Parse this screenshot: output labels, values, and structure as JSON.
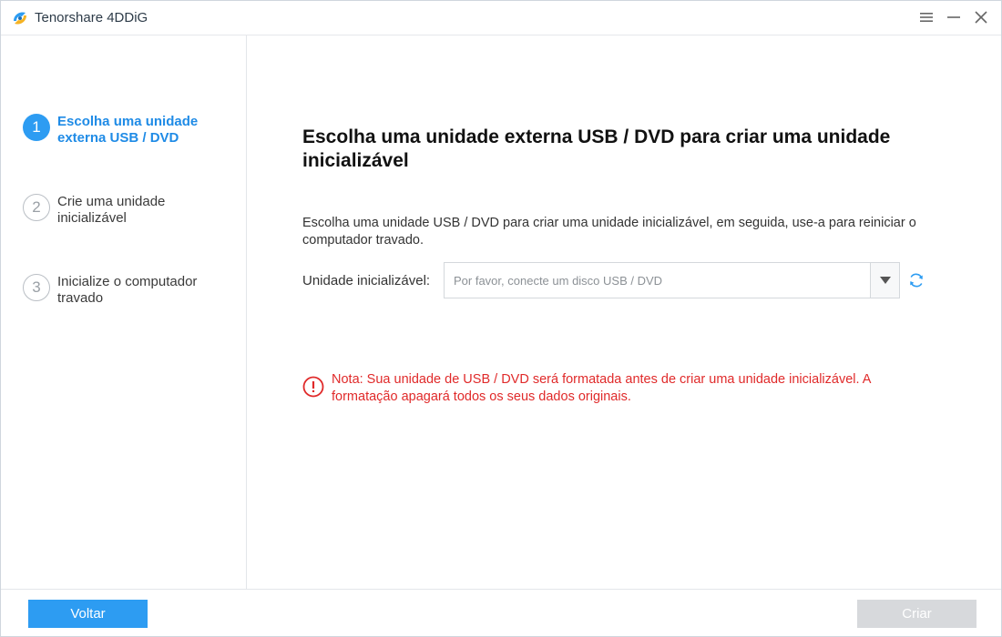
{
  "app": {
    "title": "Tenorshare 4DDiG"
  },
  "sidebar": {
    "steps": [
      {
        "number": "1",
        "label": "Escolha uma unidade externa USB / DVD",
        "state": "active"
      },
      {
        "number": "2",
        "label": "Crie uma unidade inicializável",
        "state": "inactive"
      },
      {
        "number": "3",
        "label": "Inicialize o computador travado",
        "state": "inactive"
      }
    ]
  },
  "main": {
    "title": "Escolha uma unidade externa USB / DVD para criar uma unidade inicializável",
    "description": "Escolha uma unidade USB / DVD para criar uma unidade inicializável, em seguida, use-a para reiniciar o computador travado.",
    "drive_label": "Unidade inicializável:",
    "drive_placeholder": "Por favor, conecte um disco USB / DVD",
    "warning": "Nota: Sua unidade de USB / DVD será formatada antes de criar uma unidade inicializável. A formatação apagará todos os seus dados originais."
  },
  "footer": {
    "back_label": "Voltar",
    "create_label": "Criar"
  },
  "icons": {
    "logo": "tenorshare-logo-icon",
    "menu": "menu-icon",
    "minimize": "minimize-icon",
    "close": "close-icon",
    "dropdown": "triangle-down-icon",
    "refresh": "refresh-icon",
    "warning": "exclamation-circle-icon"
  },
  "colors": {
    "accent": "#2d9cf2",
    "warning": "#e02a2a",
    "disabled_button": "#d7d9dc"
  }
}
